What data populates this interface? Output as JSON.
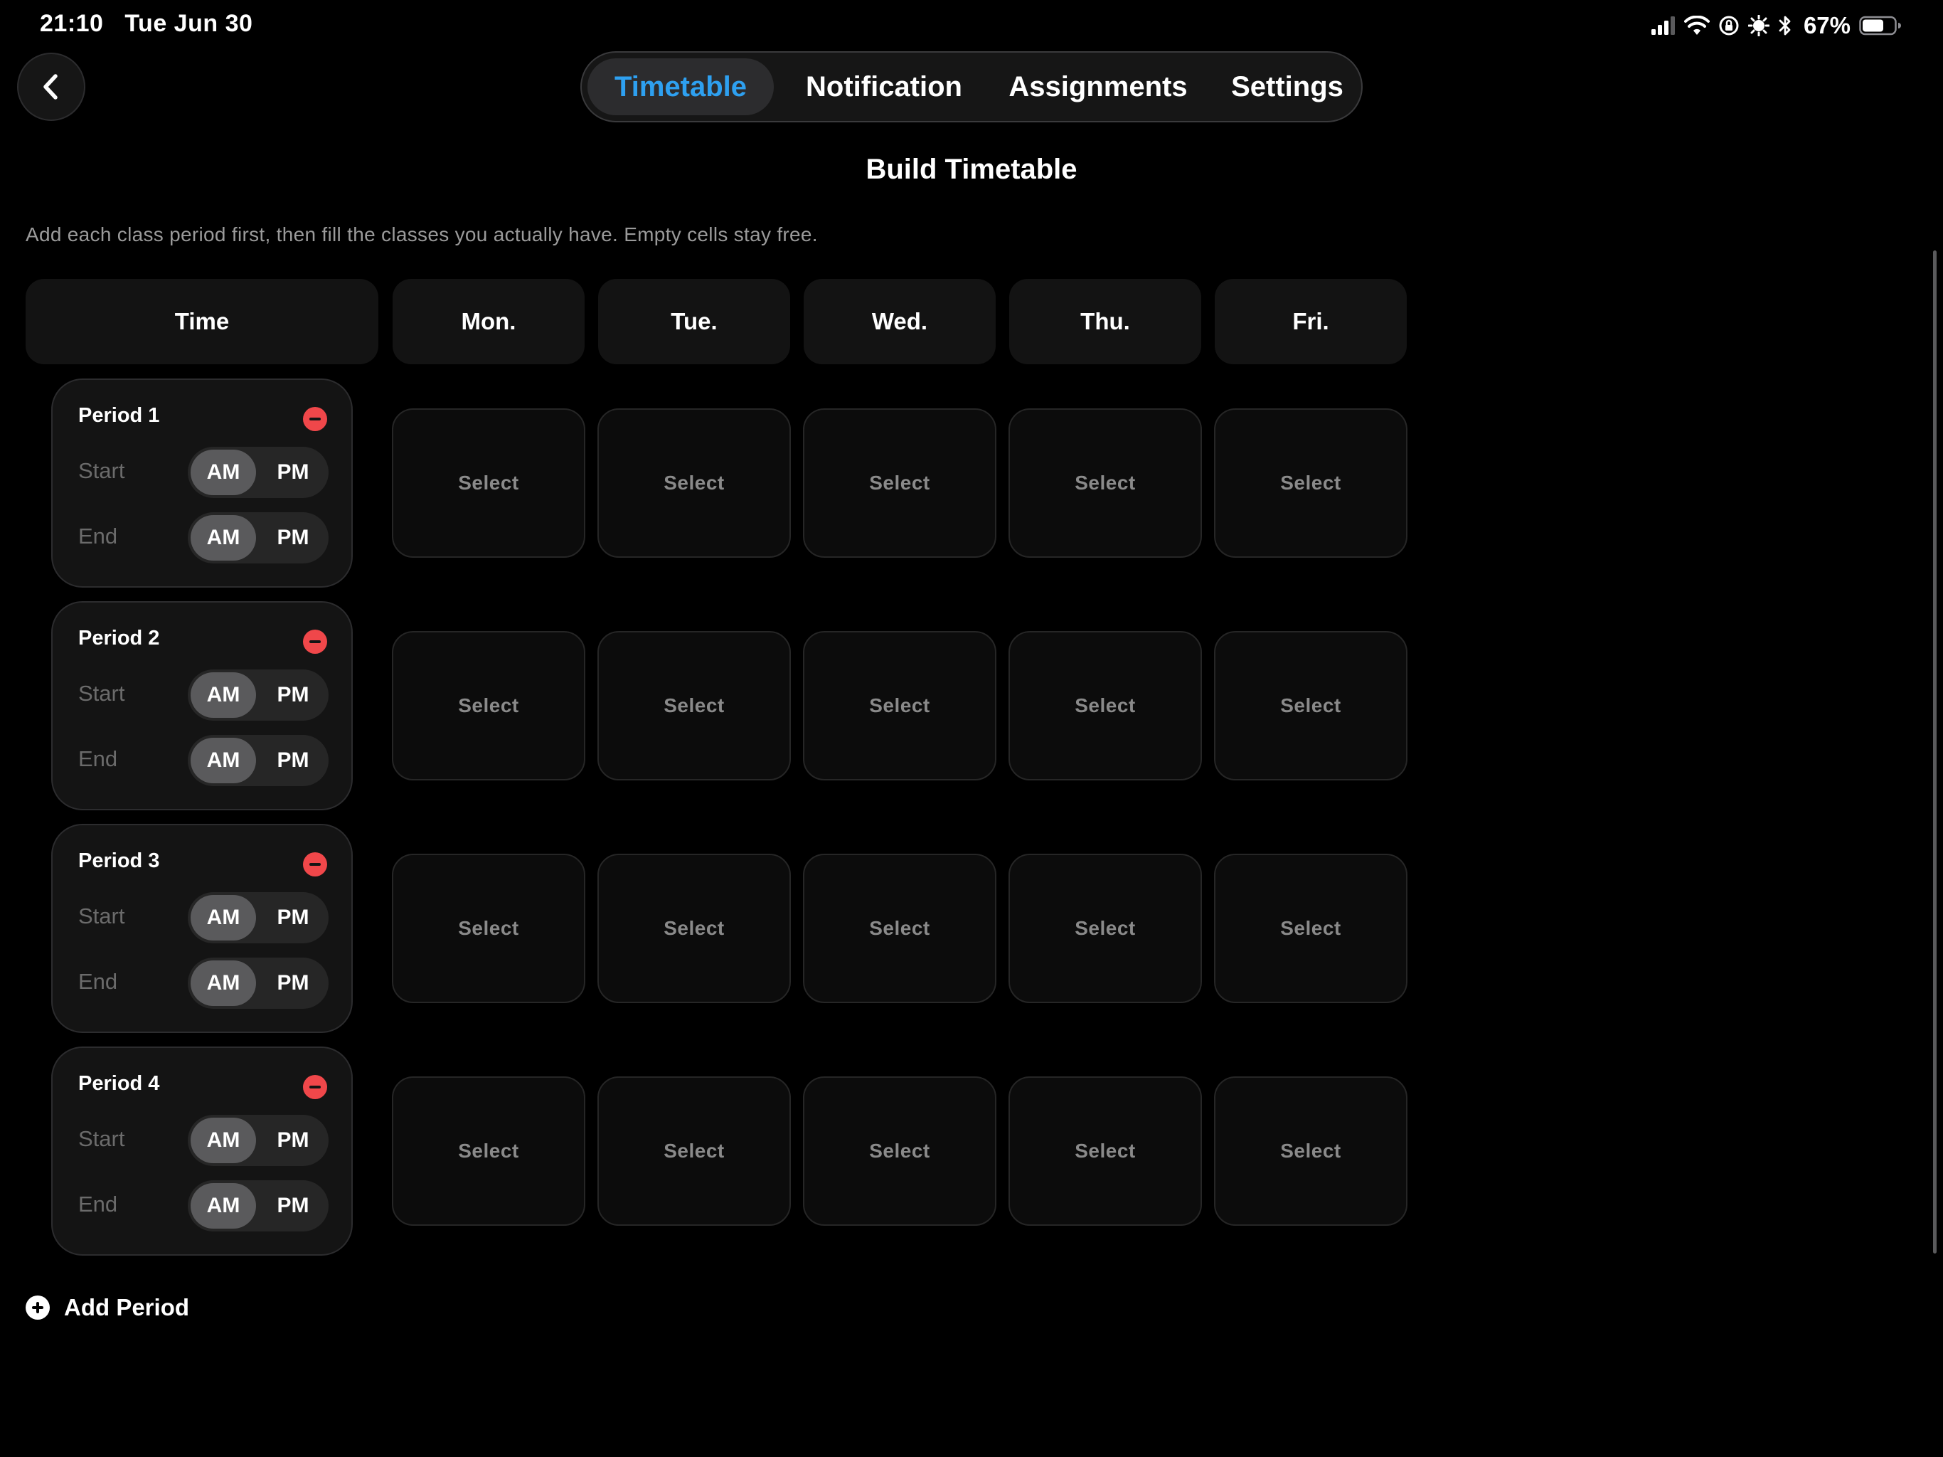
{
  "status_bar": {
    "time": "21:10",
    "date": "Tue Jun 30",
    "battery_percent": "67%",
    "battery_level": 0.67,
    "icons": [
      "cellular-signal-icon",
      "wifi-icon",
      "orientation-lock-icon",
      "focus-icon",
      "bluetooth-icon",
      "battery-icon"
    ]
  },
  "nav": {
    "back_icon": "chevron-left-icon",
    "tabs": [
      {
        "label": "Timetable",
        "active": true
      },
      {
        "label": "Notification",
        "active": false
      },
      {
        "label": "Assignments",
        "active": false
      },
      {
        "label": "Settings",
        "active": false
      }
    ]
  },
  "page": {
    "title": "Build Timetable",
    "hint": "Add each class period first, then fill the classes you actually have. Empty cells stay free."
  },
  "grid": {
    "time_header": "Time",
    "days": [
      "Mon.",
      "Tue.",
      "Wed.",
      "Thu.",
      "Fri."
    ],
    "periods": [
      {
        "name": "Period 1",
        "start_label": "Start",
        "end_label": "End",
        "start_meridiem": "AM",
        "end_meridiem": "AM",
        "am": "AM",
        "pm": "PM",
        "cells": [
          "Select",
          "Select",
          "Select",
          "Select",
          "Select"
        ]
      },
      {
        "name": "Period 2",
        "start_label": "Start",
        "end_label": "End",
        "start_meridiem": "AM",
        "end_meridiem": "AM",
        "am": "AM",
        "pm": "PM",
        "cells": [
          "Select",
          "Select",
          "Select",
          "Select",
          "Select"
        ]
      },
      {
        "name": "Period 3",
        "start_label": "Start",
        "end_label": "End",
        "start_meridiem": "AM",
        "end_meridiem": "AM",
        "am": "AM",
        "pm": "PM",
        "cells": [
          "Select",
          "Select",
          "Select",
          "Select",
          "Select"
        ]
      },
      {
        "name": "Period 4",
        "start_label": "Start",
        "end_label": "End",
        "start_meridiem": "AM",
        "end_meridiem": "AM",
        "am": "AM",
        "pm": "PM",
        "cells": [
          "Select",
          "Select",
          "Select",
          "Select",
          "Select"
        ]
      }
    ]
  },
  "add_period": {
    "label": "Add Period",
    "icon": "plus-circle-icon"
  },
  "colors": {
    "background": "#000000",
    "active_tab_text": "#2ea0f0",
    "remove": "#f0474a",
    "muted_text": "#8a8a8a"
  }
}
